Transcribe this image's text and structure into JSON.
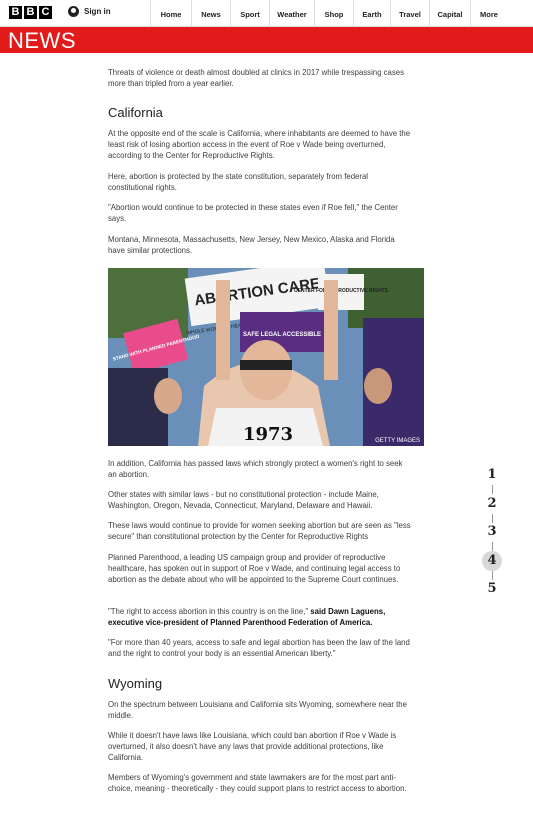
{
  "header": {
    "logo_letters": [
      "B",
      "B",
      "C"
    ],
    "sign_in": "Sign in",
    "nav": [
      "Home",
      "News",
      "Sport",
      "Weather",
      "Shop",
      "Earth",
      "Travel",
      "Capital",
      "More"
    ],
    "section_title": "NEWS"
  },
  "article": {
    "p_intro": "Threats of violence or death almost doubled at clinics in 2017 while trespassing cases more than tripled from a year earlier.",
    "h_california": "California",
    "p_ca1": "At the opposite end of the scale is California, where inhabitants are deemed to have the least risk of losing abortion access in the event of Roe v Wade being overturned, according to the Center for Reproductive Rights.",
    "p_ca2": "Here, abortion is protected by the state constitution, separately from federal constitutional rights.",
    "p_ca3": "\"Abortion would continue to be protected in these states even if Roe fell,\" the Center says.",
    "p_ca4": "Montana, Minnesota, Massachusetts, New Jersey, New Mexico, Alaska and Florida have similar protections.",
    "photo_credit": "GETTY IMAGES",
    "photo_signs": {
      "main": "ABORTION CARE",
      "center": "CENTER FOR REPRODUCTIVE RIGHTS",
      "wwh": "WHOLE WOMAN'S HEALTH",
      "pink": "STAND WITH PLANNED PARENTHOOD",
      "purple": "SAFE LEGAL ACCESSIBLE",
      "shirt": "1973"
    },
    "p_ca5": "In addition, California has passed laws which strongly protect a women's right to seek an abortion.",
    "p_ca6": "Other states with similar laws - but no constitutional protection - include Maine, Washington, Oregon, Nevada, Connecticut, Maryland, Delaware and Hawaii.",
    "p_ca7": "These laws would continue to provide for women seeking abortion but are seen as \"less secure\" than constitutional protection by the Center for Reproductive Rights",
    "p_ca8": "Planned Parenthood, a leading US campaign group and provider of reproductive healthcare, has spoken out in support of Roe v Wade, and continuing legal access to abortion as the debate about who will be appointed to the Supreme Court continues.",
    "p_quote_text": "\"The right to access abortion in this country is on the line,\"",
    "p_quote_bold": " said Dawn Laguens, executive vice-president of Planned Parenthood Federation of America.",
    "p_ca10": "\"For more than 40 years, access to safe and legal abortion has been the law of the land and the right to control your body is an essential American liberty.\"",
    "h_wyoming": "Wyoming",
    "p_wy1": "On the spectrum between Louisiana and California sits Wyoming, somewhere near the middle.",
    "p_wy2": "While it doesn't have laws like Louisiana, which could ban abortion if Roe v Wade is overturned, it also doesn't have any laws that provide additional protections, like California.",
    "p_wy3": "Members of Wyoming's government and state lawmakers are for the most part anti-choice, meaning - theoretically - they could support plans to restrict access to abortion."
  },
  "pager": {
    "pages": [
      "1",
      "2",
      "3",
      "4",
      "5"
    ],
    "active": "4"
  }
}
